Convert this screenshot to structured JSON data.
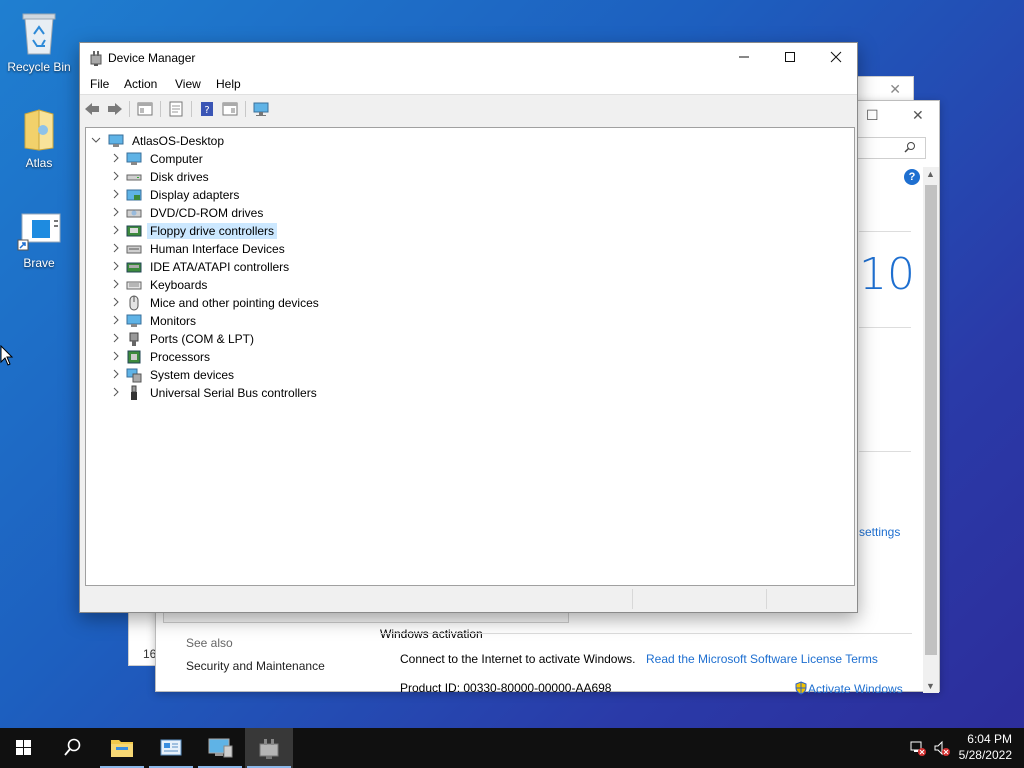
{
  "desktop": {
    "icons": [
      {
        "label": "Recycle Bin"
      },
      {
        "label": "Atlas"
      },
      {
        "label": "Brave"
      }
    ]
  },
  "background_window": {
    "version_digits": "10",
    "settings_link": "settings",
    "activation_title": "Windows activation",
    "see_also": "See also",
    "security_link": "Security and Maintenance",
    "connect_text": "Connect to the Internet to activate Windows.",
    "license_link": "Read the Microsoft Software License Terms",
    "product_id": "Product ID:  00330-80000-00000-AA698",
    "activate_link": "Activate Windows",
    "partial_number": "16"
  },
  "device_manager": {
    "title": "Device Manager",
    "menu": [
      "File",
      "Action",
      "View",
      "Help"
    ],
    "root": "AtlasOS-Desktop",
    "categories": [
      {
        "label": "Computer",
        "icon": "computer-icon"
      },
      {
        "label": "Disk drives",
        "icon": "disk-drive-icon"
      },
      {
        "label": "Display adapters",
        "icon": "display-adapter-icon"
      },
      {
        "label": "DVD/CD-ROM drives",
        "icon": "dvd-drive-icon"
      },
      {
        "label": "Floppy drive controllers",
        "icon": "floppy-controller-icon",
        "selected": true
      },
      {
        "label": "Human Interface Devices",
        "icon": "hid-icon"
      },
      {
        "label": "IDE ATA/ATAPI controllers",
        "icon": "ide-controller-icon"
      },
      {
        "label": "Keyboards",
        "icon": "keyboard-icon"
      },
      {
        "label": "Mice and other pointing devices",
        "icon": "mouse-icon"
      },
      {
        "label": "Monitors",
        "icon": "monitor-icon"
      },
      {
        "label": "Ports (COM & LPT)",
        "icon": "port-icon"
      },
      {
        "label": "Processors",
        "icon": "processor-icon"
      },
      {
        "label": "System devices",
        "icon": "system-devices-icon"
      },
      {
        "label": "Universal Serial Bus controllers",
        "icon": "usb-icon"
      }
    ]
  },
  "taskbar": {
    "time": "6:04 PM",
    "date": "5/28/2022"
  },
  "colors": {
    "accent": "#1e6fd0",
    "selection": "#cce8ff",
    "taskbar": "#101010"
  }
}
